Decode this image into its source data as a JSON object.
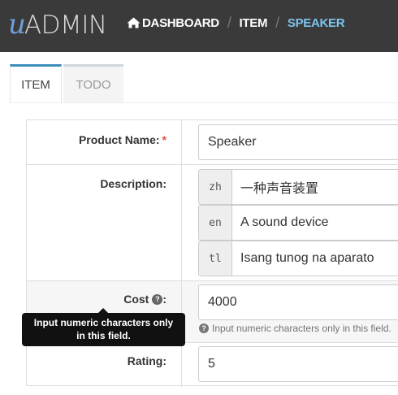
{
  "brand": {
    "logo_u": "u",
    "logo_text": "ADMIN"
  },
  "breadcrumb": {
    "home_icon": "home-icon",
    "items": [
      "DASHBOARD",
      "ITEM",
      "SPEAKER"
    ]
  },
  "tabs": [
    {
      "label": "ITEM",
      "active": true
    },
    {
      "label": "TODO",
      "active": false
    }
  ],
  "form": {
    "product_name": {
      "label": "Product Name:",
      "required_mark": "*",
      "value": "Speaker"
    },
    "description": {
      "label": "Description:",
      "translations": [
        {
          "lang": "zh",
          "value": "一种声音装置"
        },
        {
          "lang": "en",
          "value": "A sound device"
        },
        {
          "lang": "tl",
          "value": "Isang tunog na aparato"
        }
      ]
    },
    "cost": {
      "label": "Cost",
      "label_suffix": ":",
      "help_icon": "question-circle-icon",
      "value": "4000",
      "help_text": "Input numeric characters only in this field."
    },
    "rating": {
      "label": "Rating:",
      "value": "5"
    }
  },
  "tooltip": {
    "text": "Input numeric characters only in this field."
  },
  "colors": {
    "header_bg": "#3a3a3a",
    "accent": "#3c8dbc",
    "active_crumb": "#7dc4ee",
    "required": "#dd4b39"
  }
}
